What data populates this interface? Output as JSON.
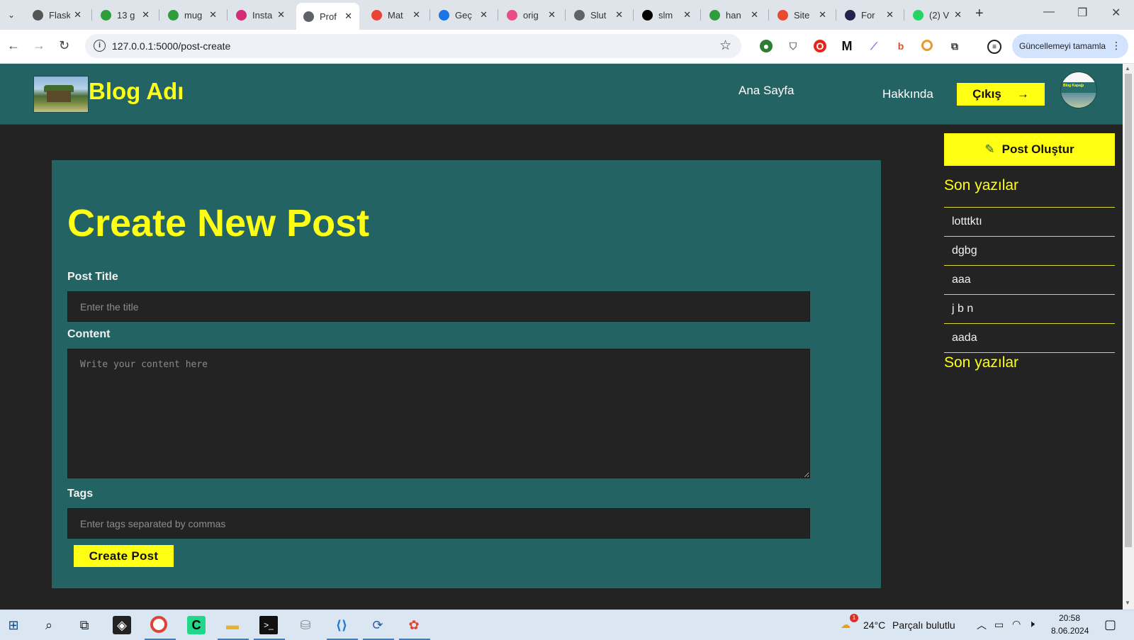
{
  "browser": {
    "tabs": [
      {
        "title": "Flask",
        "color": "#555555"
      },
      {
        "title": "13 g",
        "color": "#2e9e3d"
      },
      {
        "title": "mug",
        "color": "#2e9e3d"
      },
      {
        "title": "Insta",
        "color": "#d62976"
      },
      {
        "title": "Prof",
        "color": "#5f6368"
      },
      {
        "title": "Mat",
        "color": "#ea4335"
      },
      {
        "title": "Geç",
        "color": "#1a73e8"
      },
      {
        "title": "orig",
        "color": "#ea4c89"
      },
      {
        "title": "Slut",
        "color": "#5f6368"
      },
      {
        "title": "slm",
        "color": "#000000"
      },
      {
        "title": "han",
        "color": "#2e9e3d"
      },
      {
        "title": "Site",
        "color": "#e8492f"
      },
      {
        "title": "For",
        "color": "#24214a"
      },
      {
        "title": "(2) V",
        "color": "#25d366"
      }
    ],
    "active_tab_index": 4,
    "url": "127.0.0.1:5000/post-create",
    "update_button": "Güncellemeyi tamamla"
  },
  "header": {
    "brand": "Blog Adı",
    "nav": {
      "home": "Ana Sayfa",
      "about": "Hakkında"
    },
    "logout": "Çıkış",
    "avatar_text": "Blog Kapağı"
  },
  "form": {
    "heading": "Create New Post",
    "title_label": "Post Title",
    "title_placeholder": "Enter the title",
    "content_label": "Content",
    "content_placeholder": "Write your content here",
    "tags_label": "Tags",
    "tags_placeholder": "Enter tags separated by commas",
    "submit": "Create Post"
  },
  "sidebar": {
    "create_button": "Post Oluştur",
    "recent_heading": "Son yazılar",
    "recent_posts": [
      "lotttktı",
      "dgbg",
      "aaa",
      "j b n",
      "aada"
    ],
    "second_heading": "Son yazılar"
  },
  "taskbar": {
    "weather_temp": "24°C",
    "weather_text": "Parçalı bulutlu",
    "weather_badge": "1",
    "time": "20:58",
    "date": "8.06.2024"
  },
  "colors": {
    "accent": "#ffff14",
    "header_bg": "#246363",
    "page_bg": "#232323"
  }
}
